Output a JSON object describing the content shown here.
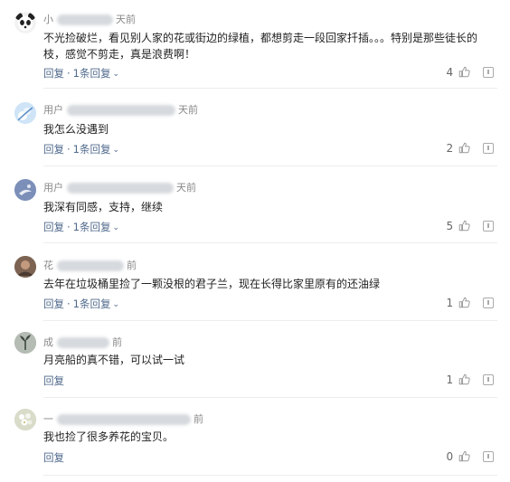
{
  "comments": [
    {
      "user": "小",
      "time": "天前",
      "text": "不光捡破烂，看见别人家的花或街边的绿植，都想剪走一段回家扦插。。。特别是那些徒长的枝，感觉不剪走，真是浪费啊！",
      "reply_label": "回复",
      "replies_label": "1条回复",
      "likes": "4",
      "avatar_icon": "panda-avatar-icon",
      "avatar_color": "#2b2b2b"
    },
    {
      "user": "用户",
      "time": "天前",
      "text": "我怎么没遇到",
      "reply_label": "回复",
      "replies_label": "1条回复",
      "likes": "2",
      "avatar_icon": "flower-avatar-icon",
      "avatar_color": "#6fa1d8"
    },
    {
      "user": "用户",
      "time": "天前",
      "text": "我深有同感，支持，继续",
      "reply_label": "回复",
      "replies_label": "1条回复",
      "likes": "5",
      "avatar_icon": "bird-avatar-icon",
      "avatar_color": "#8da0c4"
    },
    {
      "user": "花",
      "time": "前",
      "text": "去年在垃圾桶里捡了一颗没根的君子兰，现在长得比家里原有的还油绿",
      "reply_label": "回复",
      "replies_label": "1条回复",
      "likes": "1",
      "avatar_icon": "photo-avatar-icon",
      "avatar_color": "#6b5648"
    },
    {
      "user": "成",
      "time": "前",
      "text": "月亮船的真不错，可以试一试",
      "reply_label": "回复",
      "replies_label": "",
      "likes": "1",
      "avatar_icon": "plant-avatar-icon",
      "avatar_color": "#9aa39b"
    },
    {
      "user": "一",
      "time": "前",
      "text": "我也捡了很多养花的宝贝。",
      "reply_label": "回复",
      "replies_label": "",
      "likes": "0",
      "avatar_icon": "flowers-avatar-icon",
      "avatar_color": "#c9cdb8"
    }
  ]
}
